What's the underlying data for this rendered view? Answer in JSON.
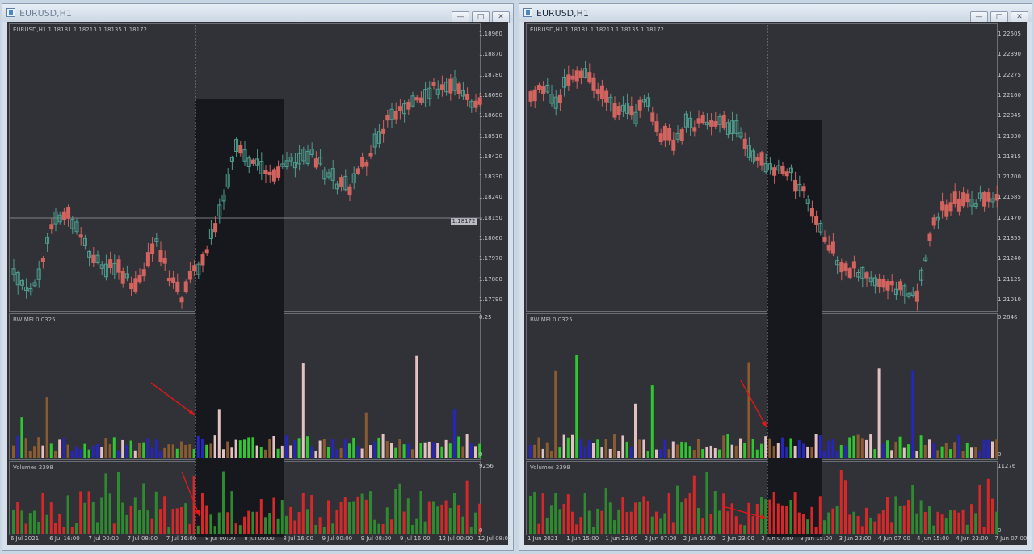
{
  "windows": [
    {
      "id": "left",
      "title": "EURUSD,H1",
      "main_label": "EURUSD,H1  1.18181 1.18213 1.18135 1.18172",
      "price_ticks": [
        "1.18960",
        "1.18870",
        "1.18780",
        "1.18690",
        "1.18600",
        "1.18510",
        "1.18420",
        "1.18330",
        "1.18240",
        "1.18150",
        "1.18060",
        "1.17970",
        "1.17880",
        "1.17790"
      ],
      "current_price": "1.18172",
      "mfi_label": "BW MFI 0.0325",
      "mfi_ticks": [
        "0.25",
        "0"
      ],
      "volumes_label": "Volumes 2398",
      "volume_ticks": [
        "9256",
        "0"
      ],
      "time_labels": [
        "6 Jul 2021",
        "6 Jul 16:00",
        "7 Jul 00:00",
        "7 Jul 08:00",
        "7 Jul 16:00",
        "8 Jul 00:00",
        "8 Jul 08:00",
        "8 Jul 16:00",
        "9 Jul 00:00",
        "9 Jul 08:00",
        "9 Jul 16:00",
        "12 Jul 00:00",
        "12 Jul 08:00"
      ],
      "marker": "3"
    },
    {
      "id": "right",
      "title": "EURUSD,H1",
      "main_label": "EURUSD,H1  1.18181 1.18213 1.18135 1.18172",
      "price_ticks": [
        "1.22505",
        "1.22390",
        "1.22275",
        "1.22160",
        "1.22045",
        "1.21930",
        "1.21815",
        "1.21700",
        "1.21585",
        "1.21470",
        "1.21355",
        "1.21240",
        "1.21125",
        "1.21010"
      ],
      "current_price": "",
      "mfi_label": "BW MFI 0.0325",
      "mfi_ticks": [
        "0.2846",
        "0"
      ],
      "volumes_label": "Volumes 2398",
      "volume_ticks": [
        "11276",
        "0"
      ],
      "time_labels": [
        "1 Jun 2021",
        "1 Jun 15:00",
        "1 Jun 23:00",
        "2 Jun 07:00",
        "2 Jun 15:00",
        "2 Jun 23:00",
        "3 Jun 07:00",
        "3 Jun 15:00",
        "3 Jun 23:00",
        "4 Jun 07:00",
        "4 Jun 15:00",
        "4 Jun 23:00",
        "7 Jun 07:00"
      ],
      "marker": "4"
    }
  ],
  "colors": {
    "background": "#303238",
    "bull_candle": "#4f9e8e",
    "bear_candle": "#d2635e",
    "mfi_green": "#2fc62f",
    "mfi_blue": "#2626b8",
    "mfi_brown": "#8a5a30",
    "mfi_pink": "#e4c1c1",
    "volume_up": "#2f8a2f",
    "volume_down": "#d62828",
    "highlight": "#16181e",
    "arrow": "#e01818",
    "marker": "#c2161a"
  }
}
